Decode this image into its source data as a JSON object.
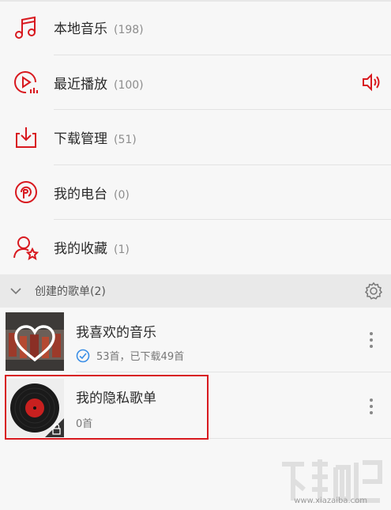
{
  "menu": {
    "items": [
      {
        "icon": "music-note-icon",
        "label": "本地音乐",
        "count": "(198)"
      },
      {
        "icon": "recent-play-icon",
        "label": "最近播放",
        "count": "(100)"
      },
      {
        "icon": "download-icon",
        "label": "下载管理",
        "count": "(51)"
      },
      {
        "icon": "radio-icon",
        "label": "我的电台",
        "count": "(0)"
      },
      {
        "icon": "favorite-user-icon",
        "label": "我的收藏",
        "count": "(1)"
      }
    ]
  },
  "section": {
    "title": "创建的歌单(2)"
  },
  "playlists": [
    {
      "name": "我喜欢的音乐",
      "info": "53首，已下载49首"
    },
    {
      "name": "我的隐私歌单",
      "info": "0首"
    }
  ],
  "watermark": {
    "url": "www.xiazaiba.com"
  },
  "colors": {
    "accent": "#d8191f",
    "background": "#f7f7f7",
    "section": "#e9e9e9"
  }
}
